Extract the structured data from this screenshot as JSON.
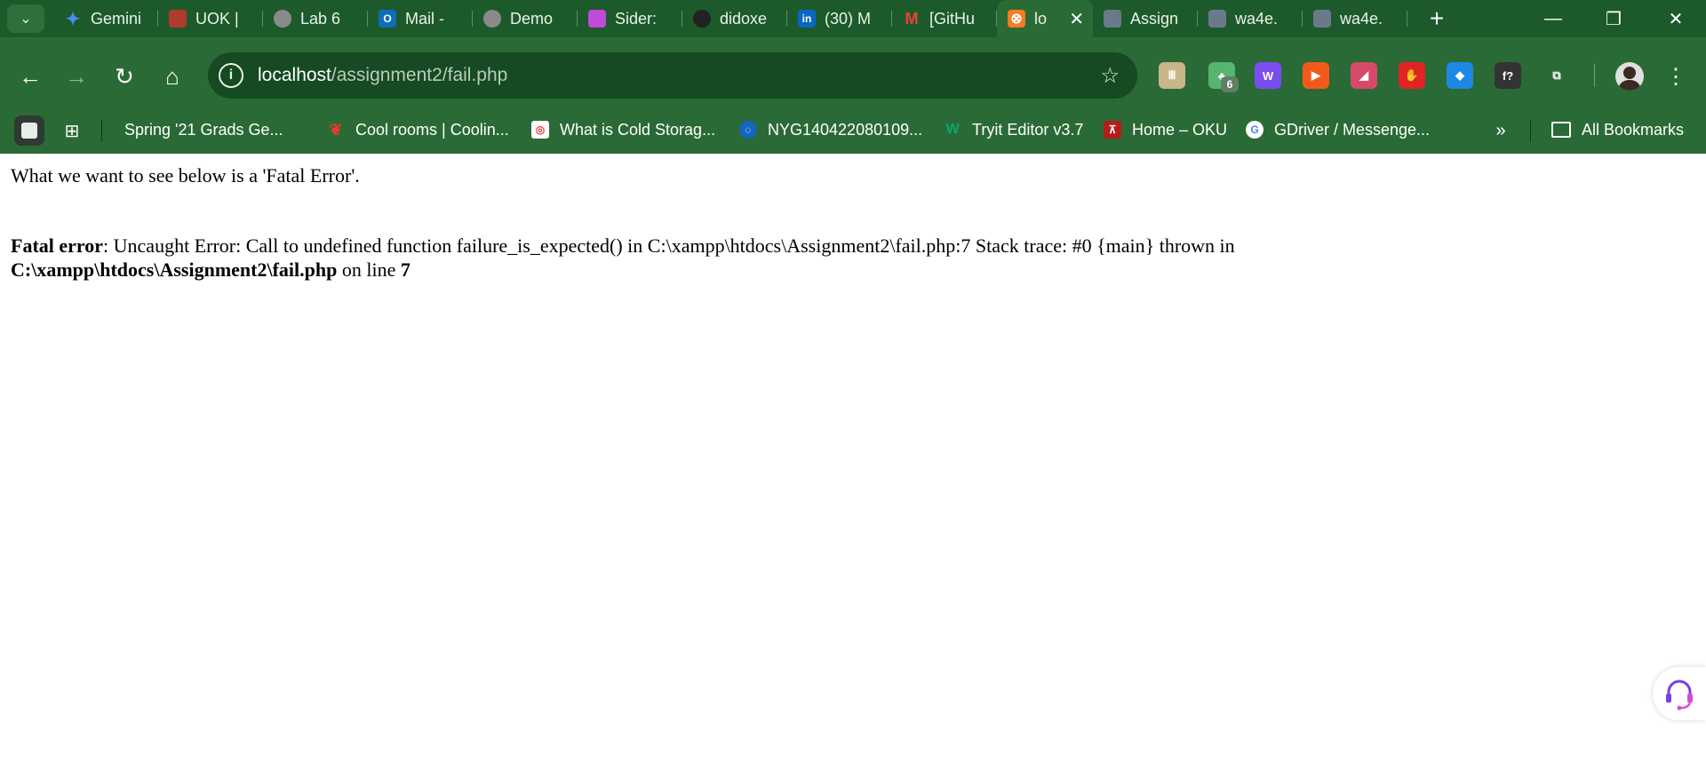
{
  "tabs": [
    {
      "label": "Gemini",
      "icon": "gemini-sparkle-icon",
      "color": "#4a8df6"
    },
    {
      "label": "UOK |",
      "icon": "uok-logo-icon",
      "color": "#b03a2e"
    },
    {
      "label": "Lab 6",
      "icon": "globe-icon",
      "color": "#8a8a8a"
    },
    {
      "label": "Mail -",
      "icon": "outlook-icon",
      "color": "#0f6cbd"
    },
    {
      "label": "Demo",
      "icon": "globe-icon",
      "color": "#8a8a8a"
    },
    {
      "label": "Sider:",
      "icon": "sider-brain-icon",
      "color": "#c04bd8"
    },
    {
      "label": "didoxe",
      "icon": "github-icon",
      "color": "#222222"
    },
    {
      "label": "(30) M",
      "icon": "linkedin-icon",
      "color": "#0a66c2"
    },
    {
      "label": "[GitHu",
      "icon": "gmail-icon",
      "color": "#ea4335"
    },
    {
      "label": "lo",
      "icon": "xampp-icon",
      "color": "#fb7a24",
      "active": true
    },
    {
      "label": "Assign",
      "icon": "avatar-thumb-icon",
      "color": "#6a7a8a"
    },
    {
      "label": "wa4e.",
      "icon": "avatar-thumb-icon",
      "color": "#6a7a8a"
    },
    {
      "label": "wa4e.",
      "icon": "avatar-thumb-icon",
      "color": "#6a7a8a"
    }
  ],
  "address": {
    "host": "localhost",
    "path": "/assignment2/fail.php"
  },
  "extensions": [
    {
      "name": "tally-icon",
      "glyph": "Ⅲ",
      "color": "#c9b58a"
    },
    {
      "name": "tree-extension-icon",
      "glyph": "♣",
      "color": "#56b56e",
      "badge": "6"
    },
    {
      "name": "w-extension-icon",
      "glyph": "W",
      "color": "#7a4df0"
    },
    {
      "name": "slides-extension-icon",
      "glyph": "▶",
      "color": "#f25a1c"
    },
    {
      "name": "flag-extension-icon",
      "glyph": "◢",
      "color": "#d84a6a"
    },
    {
      "name": "adblock-icon",
      "glyph": "✋",
      "color": "#e02424"
    },
    {
      "name": "diamond-extension-icon",
      "glyph": "◆",
      "color": "#1e88e5"
    },
    {
      "name": "font-extension-icon",
      "glyph": "f?",
      "color": "#333333"
    },
    {
      "name": "puzzle-icon",
      "glyph": "⧉",
      "color": "transparent"
    }
  ],
  "bookmarks": [
    {
      "label": "Spring '21 Grads Ge...",
      "icon": "doc-icon",
      "color": "transparent"
    },
    {
      "label": "Cool rooms | Coolin...",
      "icon": "cherry-icon",
      "color": "transparent"
    },
    {
      "label": "What is Cold Storag...",
      "icon": "cold-storage-icon",
      "color": "#ffffff"
    },
    {
      "label": "NYG140422080109...",
      "icon": "nyg-icon",
      "color": "#1565c0"
    },
    {
      "label": "Tryit Editor v3.7",
      "icon": "w3-icon",
      "color": "transparent"
    },
    {
      "label": "Home – OKU",
      "icon": "oku-icon",
      "color": "#b71c1c"
    },
    {
      "label": "GDriver / Messenge...",
      "icon": "google-icon",
      "color": "#ffffff"
    }
  ],
  "bookmarks_more": "»",
  "all_bookmarks": "All Bookmarks",
  "page": {
    "intro": "What we want to see below is a 'Fatal Error'.",
    "error_label": "Fatal error",
    "error_message": ": Uncaught Error: Call to undefined function failure_is_expected() in C:\\xampp\\htdocs\\Assignment2\\fail.php:7 Stack trace: #0 {main} thrown in",
    "error_file": "C:\\xampp\\htdocs\\Assignment2\\fail.php",
    "on_line_text": " on line ",
    "error_line": "7"
  }
}
